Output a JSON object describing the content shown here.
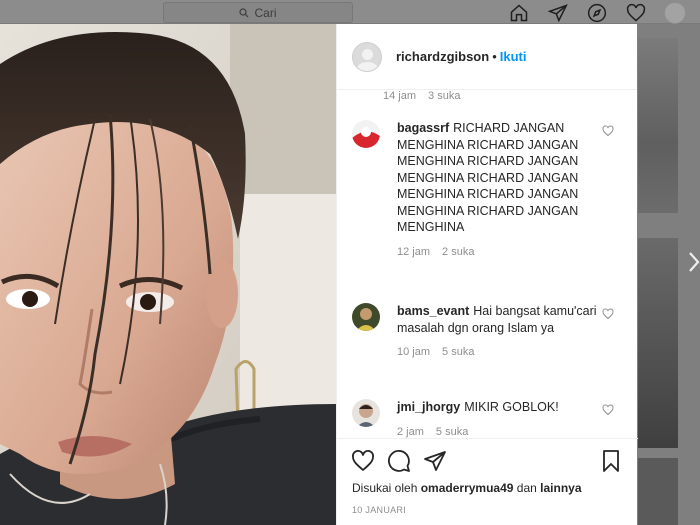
{
  "topbar": {
    "search_placeholder": "Cari",
    "icons": [
      "home-icon",
      "direct-message-icon",
      "explore-compass-icon",
      "activity-heart-icon",
      "profile-avatar"
    ]
  },
  "post": {
    "username": "richardzgibson",
    "separator": "•",
    "follow_label": "Ikuti",
    "top_meta": {
      "time": "14 jam",
      "likes": "3 suka"
    },
    "comments": [
      {
        "username": "bagassrf",
        "text": "RICHARD JANGAN MENGHINA RICHARD JANGAN MENGHINA RICHARD JANGAN MENGHINA RICHARD JANGAN MENGHINA RICHARD JANGAN MENGHINA RICHARD JANGAN MENGHINA",
        "time": "12 jam",
        "likes": "2 suka"
      },
      {
        "username": "bams_evant",
        "text": "Hai bangsat kamu'cari masalah dgn orang Islam ya",
        "time": "10 jam",
        "likes": "5 suka"
      },
      {
        "username": "jmi_jhorgy",
        "text": "MIKIR GOBLOK!",
        "time": "2 jam",
        "likes": "5 suka"
      }
    ],
    "liked_by_prefix": "Disukai oleh",
    "liked_by_user": "omaderrymua49",
    "liked_by_suffix": "dan",
    "liked_by_others": "lainnya",
    "date": "10 JANUARI"
  },
  "colors": {
    "accent_blue": "#0095f6",
    "text_primary": "#262626",
    "text_secondary": "#8e8e8e",
    "overlay": "#7f7f7f"
  }
}
